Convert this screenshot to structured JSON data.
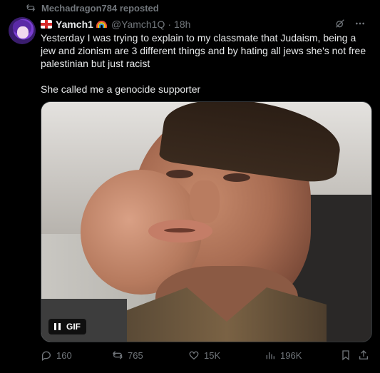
{
  "repost": {
    "label": "Mechadragon784 reposted",
    "icon": "repost-icon"
  },
  "tweet": {
    "display_name": "Yamch1",
    "handle": "@Yamch1Q",
    "separator": "·",
    "time": "18h",
    "flag_icon": "england-flag-icon",
    "emoji_icon": "rainbow-icon",
    "text": "Yesterday I was trying to explain to my classmate that Judaism, being a jew and zionism are 3 different things and by hating all jews she's not free palestinian but just racist\n\nShe called me a genocide supporter",
    "media": {
      "type": "gif",
      "badge": "GIF",
      "pause_icon": "pause-icon"
    },
    "header_icons": [
      "grok-icon",
      "more-icon"
    ]
  },
  "actions": {
    "replies": "160",
    "reposts": "765",
    "likes": "15K",
    "views": "196K"
  },
  "colors": {
    "background": "#000000",
    "text": "#e7e9ea",
    "muted": "#71767b",
    "accent": "#1d9bf0"
  }
}
